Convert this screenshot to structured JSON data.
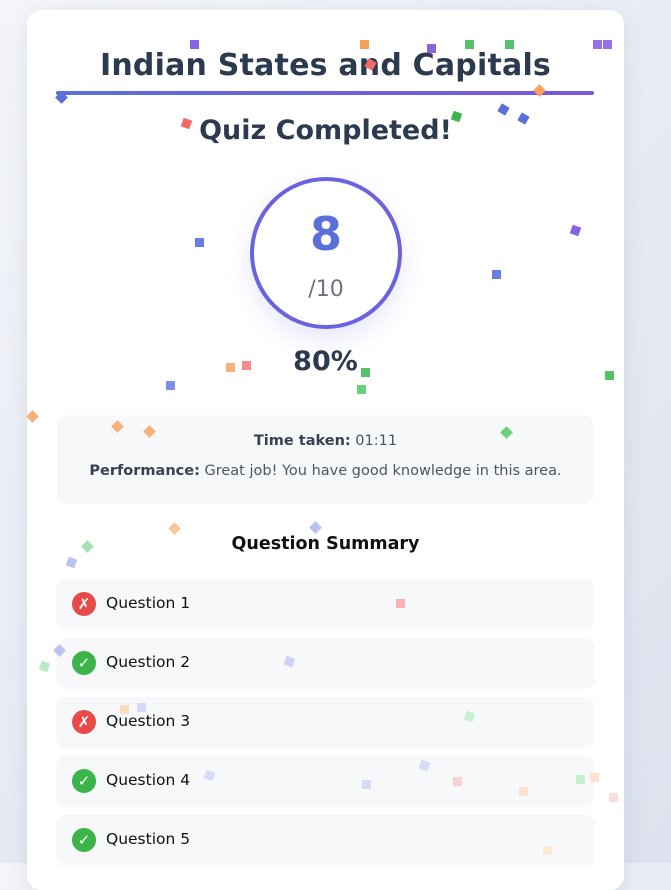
{
  "quiz": {
    "title": "Indian States and Capitals",
    "status": "Quiz Completed!",
    "score": "8",
    "total": "/10",
    "percent": "80%"
  },
  "stats": {
    "time_label": "Time taken:",
    "time_value": "01:11",
    "performance_label": "Performance:",
    "performance_value": "Great job! You have good knowledge in this area."
  },
  "summary": {
    "title": "Question Summary",
    "questions": [
      {
        "label": "Question 1",
        "result": "wrong",
        "icon": "cross-icon"
      },
      {
        "label": "Question 2",
        "result": "correct",
        "icon": "check-icon"
      },
      {
        "label": "Question 3",
        "result": "wrong",
        "icon": "cross-icon"
      },
      {
        "label": "Question 4",
        "result": "correct",
        "icon": "check-icon"
      },
      {
        "label": "Question 5",
        "result": "correct",
        "icon": "check-icon"
      }
    ]
  },
  "colors": {
    "accent": "#5b6fd8",
    "accent_purple": "#7b57d6",
    "correct": "#3bb54a",
    "wrong": "#e84a4a",
    "text_dark": "#2c3a4f"
  }
}
